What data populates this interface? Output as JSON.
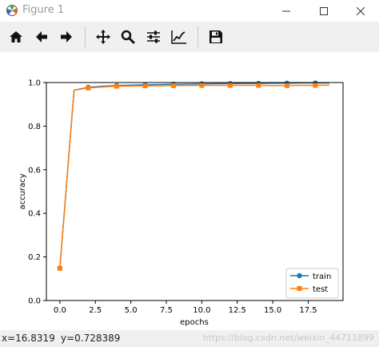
{
  "window": {
    "title": "Figure 1",
    "icon": "matplotlib-icon",
    "controls": [
      "minimize-icon",
      "maximize-icon",
      "close-icon"
    ]
  },
  "toolbar": {
    "buttons": [
      "home-icon",
      "back-arrow-icon",
      "forward-arrow-icon",
      "pan-icon",
      "zoom-icon",
      "configure-subplots-icon",
      "edit-axes-icon",
      "save-icon"
    ]
  },
  "status": {
    "x_readout": "x=16.8319",
    "y_readout": "y=0.728389",
    "watermark": "https://blog.csdn.net/weixin_44711899"
  },
  "chart_data": {
    "type": "line",
    "title": "",
    "xlabel": "epochs",
    "ylabel": "accuracy",
    "xlim": [
      -0.95,
      19.95
    ],
    "ylim": [
      0.0,
      1.0
    ],
    "xticks": [
      0.0,
      2.5,
      5.0,
      7.5,
      10.0,
      12.5,
      15.0,
      17.5
    ],
    "xtick_labels": [
      "0.0",
      "2.5",
      "5.0",
      "7.5",
      "10.0",
      "12.5",
      "15.0",
      "17.5"
    ],
    "yticks": [
      0.0,
      0.2,
      0.4,
      0.6,
      0.8,
      1.0
    ],
    "ytick_labels": [
      "0.0",
      "0.2",
      "0.4",
      "0.6",
      "0.8",
      "1.0"
    ],
    "grid": false,
    "legend_position": "lower-right",
    "x": [
      0,
      1,
      2,
      3,
      4,
      5,
      6,
      7,
      8,
      9,
      10,
      11,
      12,
      13,
      14,
      15,
      16,
      17,
      18,
      19
    ],
    "series": [
      {
        "name": "train",
        "color": "#1f77b4",
        "marker": "circle",
        "markevery": 2,
        "values": [
          0.148,
          0.965,
          0.978,
          0.983,
          0.986,
          0.988,
          0.99,
          0.991,
          0.992,
          0.993,
          0.994,
          0.995,
          0.995,
          0.996,
          0.996,
          0.997,
          0.997,
          0.998,
          0.998,
          0.998
        ]
      },
      {
        "name": "test",
        "color": "#ff7f0e",
        "marker": "square",
        "markevery": 2,
        "values": [
          0.148,
          0.965,
          0.975,
          0.98,
          0.983,
          0.984,
          0.985,
          0.985,
          0.986,
          0.986,
          0.987,
          0.987,
          0.987,
          0.987,
          0.987,
          0.986,
          0.986,
          0.987,
          0.987,
          0.988
        ]
      }
    ]
  }
}
